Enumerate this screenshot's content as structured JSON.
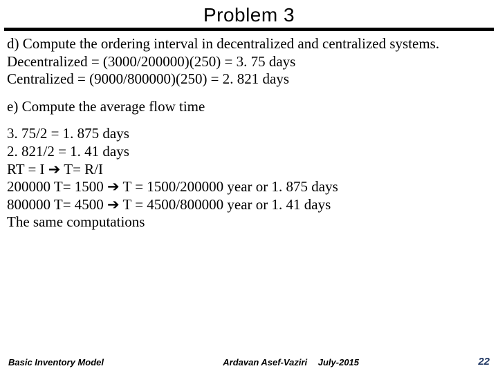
{
  "title": "Problem 3",
  "section_d": {
    "prompt": "d) Compute the ordering interval in decentralized and centralized systems.",
    "line1": "Decentralized = (3000/200000)(250) = 3. 75 days",
    "line2": "Centralized = (9000/800000)(250) = 2. 821 days"
  },
  "section_e": {
    "prompt": "e) Compute the average flow time",
    "line1": " 3. 75/2 = 1. 875 days",
    "line2": "2. 821/2 =  1. 41 days",
    "line3": "RT = I  ➔ T= R/I",
    "line4": "200000 T= 1500  ➔ T = 1500/200000 year or 1. 875 days",
    "line5": "800000 T= 4500  ➔ T = 4500/800000 year or 1. 41 days",
    "line6": "The same computations"
  },
  "footer": {
    "left": "Basic Inventory Model",
    "center_name": "Ardavan Asef-Vaziri",
    "center_date": "July-2015",
    "page": "22"
  }
}
